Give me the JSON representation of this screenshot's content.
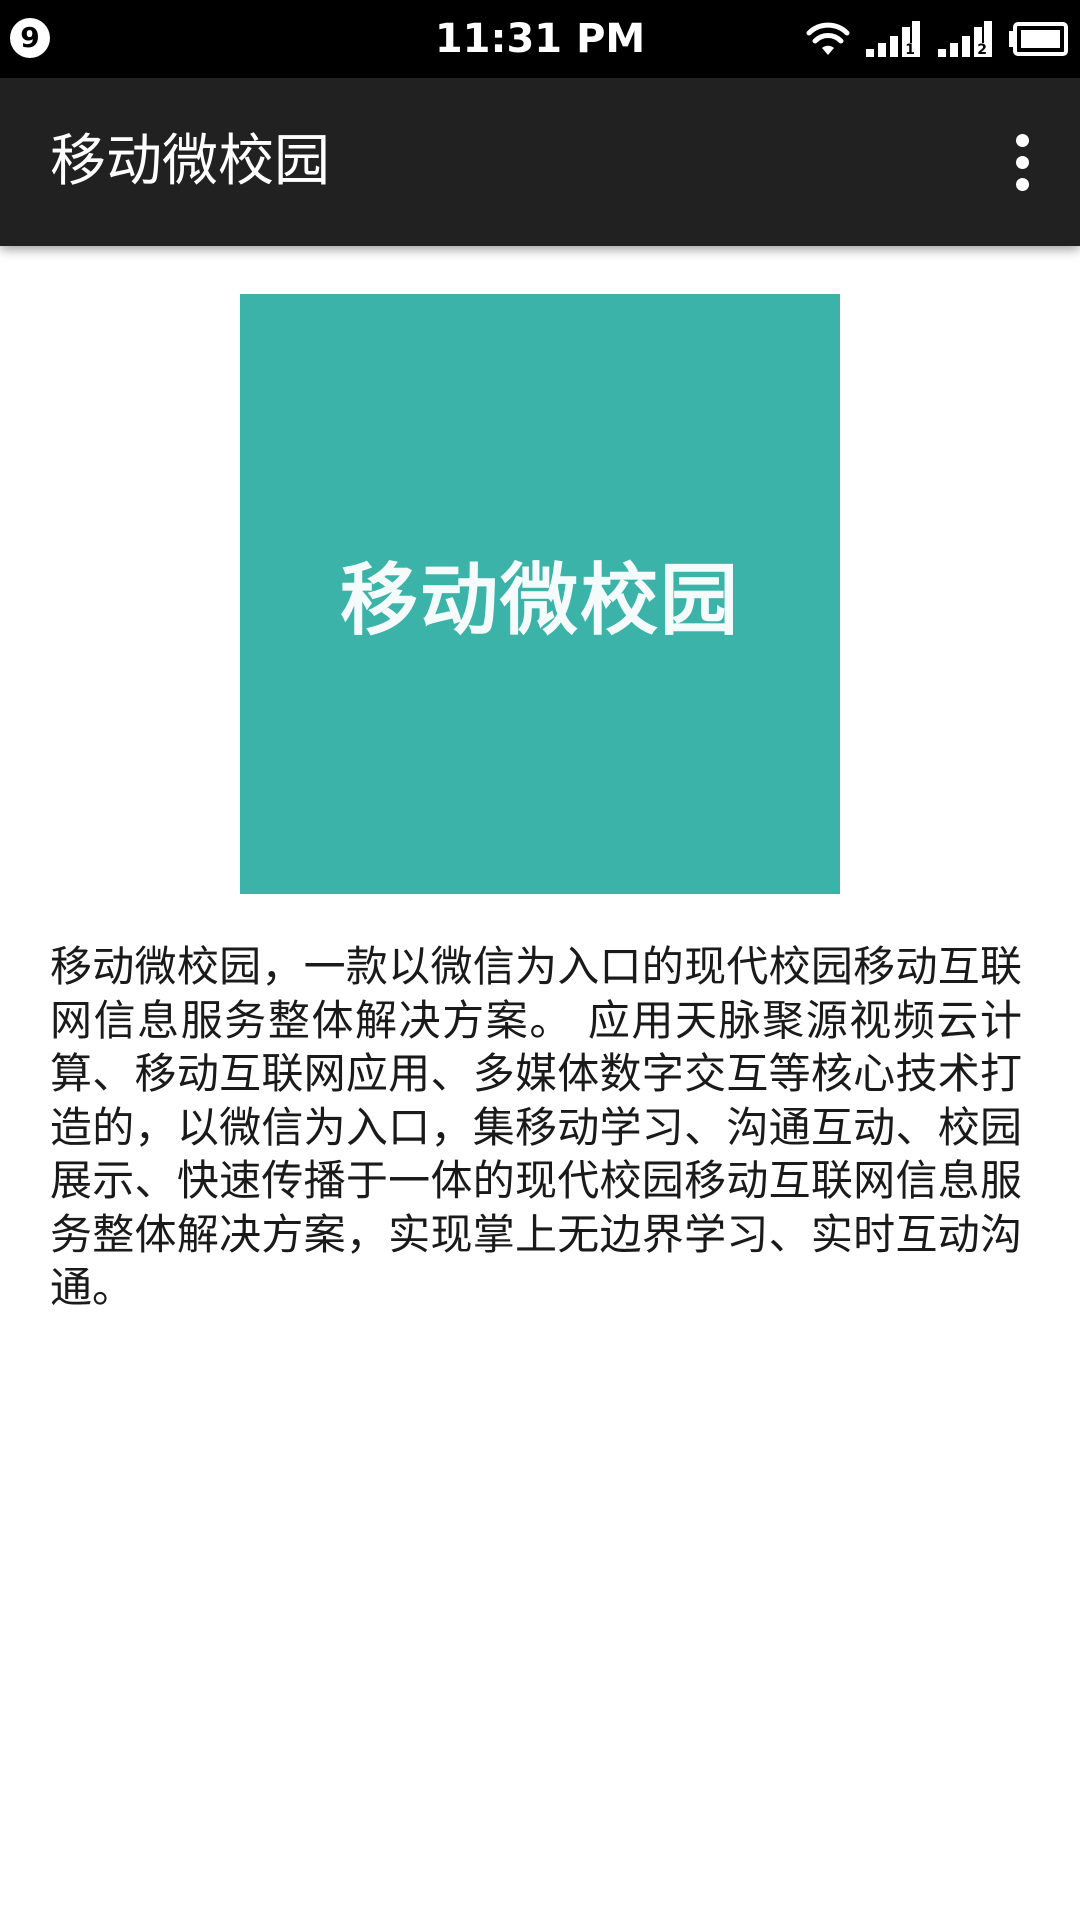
{
  "status_bar": {
    "notification_count": "9",
    "time": "11:31 PM",
    "icons": [
      "wifi-icon",
      "signal-sim1-icon",
      "signal-sim2-icon",
      "battery-icon"
    ],
    "sim1_label": "1",
    "sim2_label": "2"
  },
  "app_bar": {
    "title": "移动微校园",
    "menu_icon": "overflow-menu-icon"
  },
  "banner": {
    "text": "移动微校园",
    "color": "#3bb3a9"
  },
  "description": "移动微校园，一款以微信为入口的现代校园移动互联网信息服务整体解决方案。 应用天脉聚源视频云计算、移动互联网应用、多媒体数字交互等核心技术打造的，以微信为入口，集移动学习、沟通互动、校园展示、快速传播于一体的现代校园移动互联网信息服务整体解决方案，实现掌上无边界学习、实时互动沟通。"
}
